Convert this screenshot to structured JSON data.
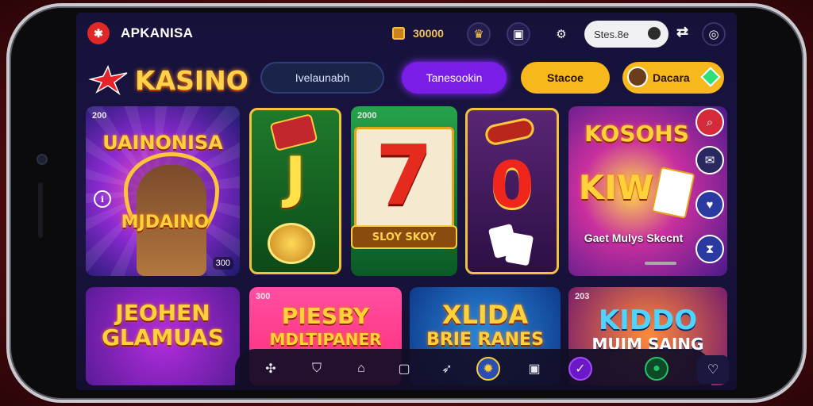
{
  "header": {
    "app_name": "APKANISA",
    "coin_amount": "30000",
    "search_value": "Stes.8e"
  },
  "nav": {
    "brand": "KASINO",
    "pill_1": "Ivelaunabh",
    "pill_2": "Tanesookin",
    "pill_3": "Stacoe",
    "pill_4": "Dacara"
  },
  "cards": {
    "c1_tag": "200",
    "c1_title_top": "UAINONISA",
    "c1_title_bottom": "MJDAINO",
    "c1_count": "300",
    "c3_tag": "2000",
    "c3_number": "7",
    "c3_banner": "SLOY SKOY",
    "c2_symbol": "J",
    "c4_symbol": "0",
    "c5_title_top": "KOSOHS",
    "c5_title_bottom": "KIW",
    "c5_caption": "Gaet Mulys Skecnt",
    "c6_title": "JEOHEN GLAMUAS",
    "c7_tag": "300",
    "c7_title_top": "PIESBY",
    "c7_title_bottom": "MDLTIPANER",
    "c8_title_top": "XLIDA",
    "c8_title_bottom": "BRIE RANES",
    "c9_tag": "203",
    "c9_title_top": "KIDDO",
    "c9_title_bottom": "MUIM SAING"
  },
  "colors": {
    "accent_yellow": "#f7b81c",
    "accent_purple": "#7a1de6",
    "screen_bg": "#15123a",
    "brand_red": "#e02828"
  },
  "icons": [
    "app-logo-icon",
    "coin-icon",
    "trophy-icon",
    "gallery-icon",
    "settings-icon",
    "profile-mini-icon",
    "refresh-icon",
    "globe-icon",
    "star-logo-icon",
    "search-icon",
    "chat-icon",
    "heart-icon",
    "hourglass-icon",
    "puzzle-icon",
    "shield-icon",
    "home-icon",
    "square-icon",
    "rocket-icon",
    "flame-icon",
    "stop-icon",
    "check-icon",
    "circle-icon",
    "heart-badge-icon"
  ]
}
